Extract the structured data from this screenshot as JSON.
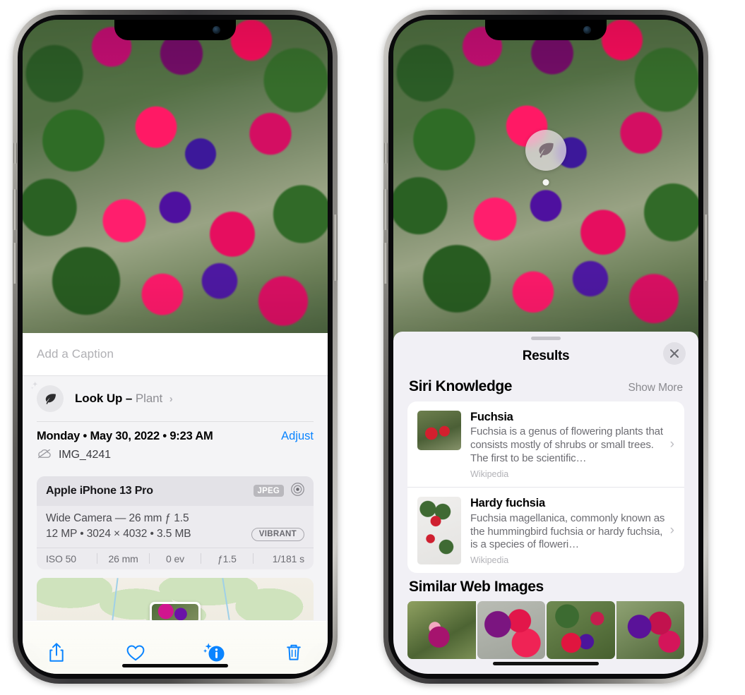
{
  "left_phone": {
    "caption": {
      "placeholder": "Add a Caption",
      "value": ""
    },
    "look_up": {
      "label": "Look Up",
      "dash": "–",
      "subject": "Plant",
      "chevron": "›",
      "icon": "leaf-icon"
    },
    "info": {
      "date": "Monday • May 30, 2022 • 9:23 AM",
      "adjust_label": "Adjust",
      "filename": "IMG_4241",
      "cloud_icon": "icloud-slash-icon"
    },
    "exif": {
      "device": "Apple iPhone 13 Pro",
      "format_tag": "JPEG",
      "aperture_icon": "camera-lens-icon",
      "lens_line": "Wide Camera — 26 mm ƒ 1.5",
      "specs_line": "12 MP • 3024 × 4032 • 3.5 MB",
      "style_tag": "VIBRANT",
      "settings": [
        "ISO 50",
        "26 mm",
        "0 ev",
        "ƒ1.5",
        "1/181 s"
      ]
    },
    "toolbar": [
      {
        "name": "share-button",
        "icon": "share-icon"
      },
      {
        "name": "favorite-button",
        "icon": "heart-icon"
      },
      {
        "name": "info-button",
        "icon": "info-sparkle-icon"
      },
      {
        "name": "delete-button",
        "icon": "trash-icon"
      }
    ],
    "accent_color": "#0a84ff"
  },
  "right_phone": {
    "badge": {
      "icon": "leaf-icon",
      "name": "visual-look-up-badge"
    },
    "sheet": {
      "title": "Results",
      "close_icon": "close-icon",
      "siri": {
        "title": "Siri Knowledge",
        "show_more": "Show More",
        "items": [
          {
            "title": "Fuchsia",
            "description": "Fuchsia is a genus of flowering plants that consists mostly of shrubs or small trees. The first to be scientific…",
            "source": "Wikipedia"
          },
          {
            "title": "Hardy fuchsia",
            "description": "Fuchsia magellanica, commonly known as the hummingbird fuchsia or hardy fuchsia, is a species of floweri…",
            "source": "Wikipedia"
          }
        ]
      },
      "web": {
        "title": "Similar Web Images",
        "count": 4
      }
    }
  }
}
